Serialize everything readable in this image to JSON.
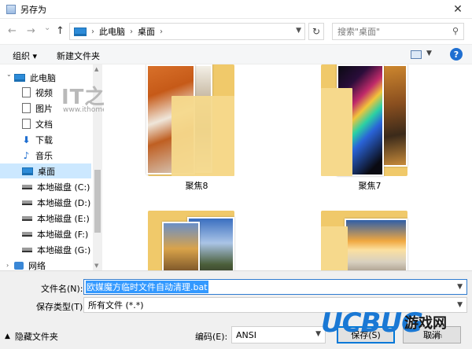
{
  "window": {
    "title": "另存为",
    "close_glyph": "✕"
  },
  "nav": {
    "back_glyph": "←",
    "forward_glyph": "→",
    "recent_glyph": "⌄",
    "up_glyph": "↑",
    "breadcrumbs": [
      "此电脑",
      "桌面"
    ],
    "crumb_sep": "›",
    "refresh_glyph": "↻",
    "search_placeholder": "搜索\"桌面\"",
    "search_icon": "search-icon"
  },
  "toolbar": {
    "organize": "组织 ▾",
    "new_folder": "新建文件夹",
    "help": "?"
  },
  "sidebar": {
    "items": [
      {
        "label": "此电脑",
        "icon": "computer-icon"
      },
      {
        "label": "视频",
        "icon": "video-icon"
      },
      {
        "label": "图片",
        "icon": "picture-icon"
      },
      {
        "label": "文档",
        "icon": "document-icon"
      },
      {
        "label": "下载",
        "icon": "download-icon",
        "glyph": "⬇"
      },
      {
        "label": "音乐",
        "icon": "music-icon",
        "glyph": "♪"
      },
      {
        "label": "桌面",
        "icon": "desktop-icon",
        "selected": true
      },
      {
        "label": "本地磁盘 (C:)",
        "icon": "drive-icon"
      },
      {
        "label": "本地磁盘 (D:)",
        "icon": "drive-icon"
      },
      {
        "label": "本地磁盘 (E:)",
        "icon": "drive-icon"
      },
      {
        "label": "本地磁盘 (F:)",
        "icon": "drive-icon"
      },
      {
        "label": "本地磁盘 (G:)",
        "icon": "drive-icon"
      },
      {
        "label": "网络",
        "icon": "network-icon"
      }
    ]
  },
  "watermark": {
    "logo": "IT之家",
    "url": "www.ithome.com"
  },
  "folders": [
    {
      "label": "聚焦8"
    },
    {
      "label": "聚焦7"
    },
    {
      "label": ""
    },
    {
      "label": ""
    }
  ],
  "form": {
    "filename_label": "文件名(N):",
    "filename_value": "欧媒魔方临时文件自动清理.bat",
    "filetype_label": "保存类型(T):",
    "filetype_value": "所有文件 (*.*)",
    "hide_folders": "隐藏文件夹",
    "encoding_label": "编码(E):",
    "encoding_value": "ANSI",
    "save": "保存(S)",
    "cancel": "取消"
  },
  "brand": {
    "logo": "UCBUG",
    "cn": "游戏网",
    "com": ".com"
  },
  "colors": {
    "accent": "#0078d7",
    "selection": "#cce8ff",
    "folder": "#f0c96a"
  }
}
